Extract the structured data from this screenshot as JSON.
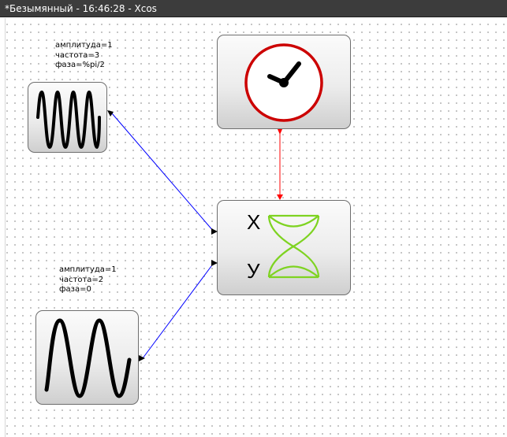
{
  "window": {
    "title": "*Безымянный - 16:46:28 - Xcos"
  },
  "blocks": {
    "sine1": {
      "params": [
        "амплитуда=1",
        "частота=3",
        "фаза=%pi/2"
      ],
      "icon": "sine-wave-icon"
    },
    "sine2": {
      "params": [
        "амплитуда=1",
        "частота=2",
        "фаза=0"
      ],
      "icon": "sine-wave-icon"
    },
    "clock": {
      "icon": "clock-icon",
      "colors": {
        "ring": "#cc0000",
        "hands": "#000000"
      }
    },
    "scope": {
      "icon": "xy-scope-icon",
      "x_label": "X",
      "y_label": "У",
      "colors": {
        "curves": "#7ed321"
      }
    }
  },
  "links": {
    "data_color": "#0000ff",
    "activation_color": "#ff0000"
  }
}
